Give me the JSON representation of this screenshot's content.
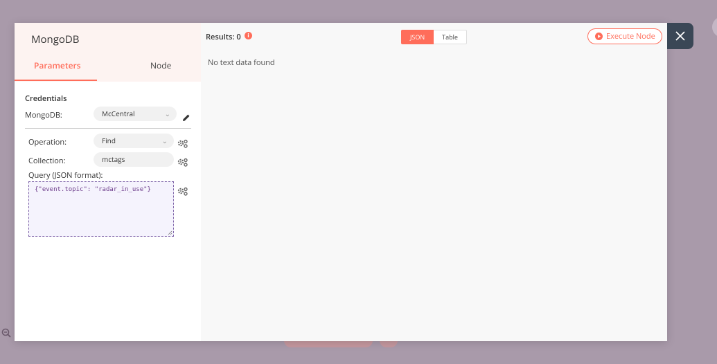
{
  "dialog": {
    "node_title": "MongoDB",
    "tabs": [
      {
        "label": "Parameters",
        "active": true
      },
      {
        "label": "Node",
        "active": false
      }
    ]
  },
  "credentials": {
    "section_title": "Credentials",
    "mongodb_label": "MongoDB:",
    "mongodb_value": "McCentral"
  },
  "parameters": {
    "operation_label": "Operation:",
    "operation_value": "Find",
    "collection_label": "Collection:",
    "collection_value": "mctags",
    "query_label": "Query (JSON format):",
    "query_value": "{\"event.topic\": \"radar_in_use\"}"
  },
  "results": {
    "label": "Results: 0",
    "views": [
      {
        "label": "JSON",
        "active": true
      },
      {
        "label": "Table",
        "active": false
      }
    ],
    "execute_label": "Execute Node",
    "empty_message": "No text data found"
  },
  "colors": {
    "accent": "#ff6d5a",
    "backdrop": "#a99aaa",
    "close_button": "#3a4756"
  },
  "icons": {
    "edit": "pencil-icon",
    "options": "gear-icon",
    "info": "info-icon",
    "play": "play-circle-icon",
    "close": "close-icon",
    "zoom": "zoom-out-icon"
  }
}
